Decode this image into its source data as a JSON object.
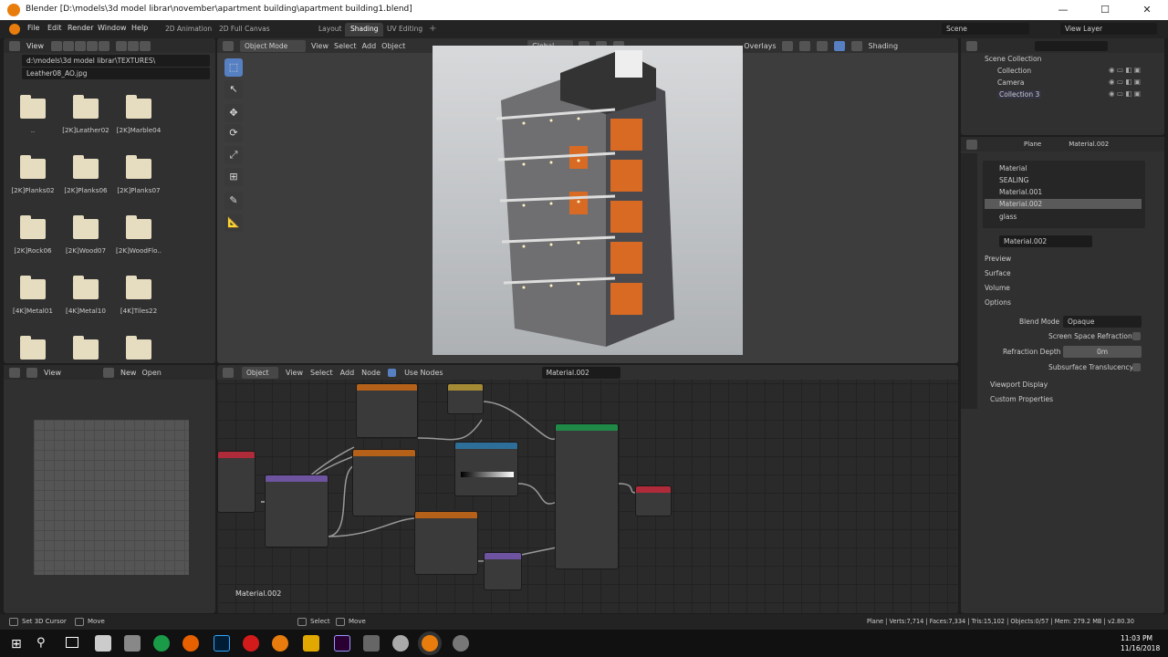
{
  "window": {
    "title": "Blender [D:\\models\\3d model librar\\november\\apartment building\\apartment building1.blend]",
    "min": "—",
    "max": "☐",
    "close": "✕"
  },
  "menu": [
    "File",
    "Edit",
    "Render",
    "Window",
    "Help"
  ],
  "workspaces": [
    "2D Animation",
    "2D Full Canvas",
    "Layout",
    "Shading",
    "UV Editing"
  ],
  "active_workspace": "Shading",
  "scene": {
    "label": "Scene",
    "view_layer": "View Layer"
  },
  "filebrowser": {
    "view_label": "View",
    "path": "d:\\models\\3d model librar\\TEXTURES\\",
    "file": "Leather08_AO.jpg",
    "items": [
      "..",
      "[2K]Leather02",
      "[2K]Marble04",
      "[2K]Planks02",
      "[2K]Planks06",
      "[2K]Planks07",
      "[2K]Rock06",
      "[2K]Wood07",
      "[2K]WoodFlo..",
      "[4K]Metal01",
      "[4K]Metal10",
      "[4K]Tiles22",
      "",
      "",
      ""
    ]
  },
  "viewport": {
    "mode": "Object Mode",
    "menu": [
      "View",
      "Select",
      "Add",
      "Object"
    ],
    "transform": "Global",
    "overlays": "Overlays",
    "shading": "Shading"
  },
  "outliner": {
    "root": "Scene Collection",
    "items": [
      {
        "name": "Collection"
      },
      {
        "name": "Camera"
      },
      {
        "name": "Collection 3"
      }
    ]
  },
  "properties": {
    "object": "Plane",
    "material_tab": "Material.002",
    "slots": [
      "Material",
      "SEALING",
      "Material.001",
      "Material.002",
      "glass"
    ],
    "active_slot": "Material.002",
    "material_name": "Material.002",
    "panels": [
      "Preview",
      "Surface",
      "Volume",
      "Options"
    ],
    "blend_mode_label": "Blend Mode",
    "blend_mode": "Opaque",
    "ssr_label": "Screen Space Refraction",
    "refraction_depth_label": "Refraction Depth",
    "refraction_depth": "0m",
    "sss_label": "Subsurface Translucency",
    "viewport_display": "Viewport Display",
    "custom_properties": "Custom Properties"
  },
  "imageeditor": {
    "view": "View",
    "new": "New",
    "open": "Open"
  },
  "nodeeditor": {
    "object": "Object",
    "menu": [
      "View",
      "Select",
      "Add",
      "Node"
    ],
    "use_nodes": "Use Nodes",
    "material": "Material.002",
    "label": "Material.002"
  },
  "statusbar": {
    "left1": "Set 3D Cursor",
    "left2": "Move",
    "mid1": "Select",
    "mid2": "Move",
    "right": "Plane | Verts:7,714 | Faces:7,334 | Tris:15,102 | Objects:0/57 | Mem: 279.2 MB | v2.80.30"
  },
  "taskbar": {
    "time": "11:03 PM",
    "date": "11/16/2018"
  },
  "colors": {
    "accent": "#5680c2",
    "orange": "#e0781f",
    "panel": "#303030",
    "header": "#2b2b2b"
  }
}
